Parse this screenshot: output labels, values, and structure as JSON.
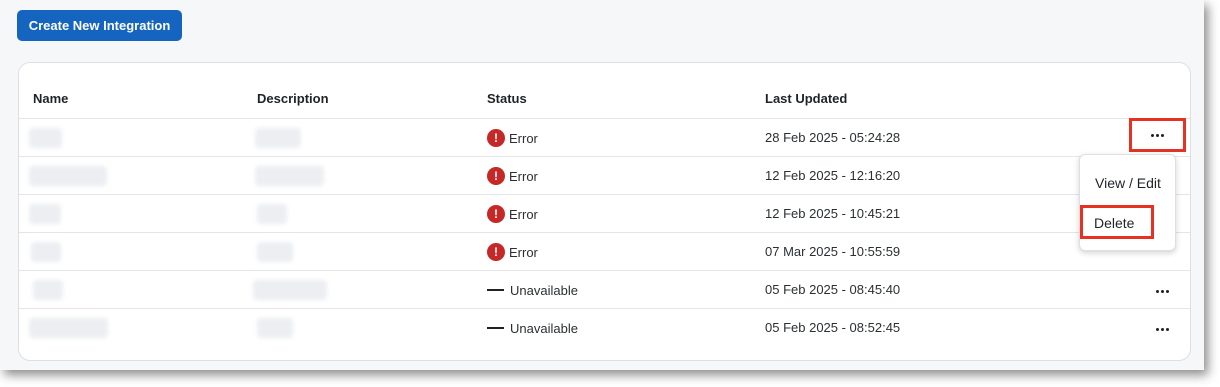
{
  "toolbar": {
    "create_label": "Create New Integration"
  },
  "table": {
    "headers": {
      "name": "Name",
      "description": "Description",
      "status": "Status",
      "last_updated": "Last Updated"
    },
    "rows": [
      {
        "status_icon": "error-icon",
        "status": "Error",
        "last_updated": "28 Feb 2025 - 05:24:28"
      },
      {
        "status_icon": "error-icon",
        "status": "Error",
        "last_updated": "12 Feb 2025 - 12:16:20"
      },
      {
        "status_icon": "error-icon",
        "status": "Error",
        "last_updated": "12 Feb 2025 - 10:45:21"
      },
      {
        "status_icon": "error-icon",
        "status": "Error",
        "last_updated": "07 Mar 2025 - 10:55:59"
      },
      {
        "status_icon": "dash-icon",
        "status": "Unavailable",
        "last_updated": "05 Feb 2025 - 08:45:40"
      },
      {
        "status_icon": "dash-icon",
        "status": "Unavailable",
        "last_updated": "05 Feb 2025 - 08:52:45"
      }
    ]
  },
  "context_menu": {
    "items": [
      "View / Edit",
      "Delete"
    ]
  },
  "colors": {
    "primary": "#1565c0",
    "error": "#c62828",
    "highlight": "#e53222"
  }
}
